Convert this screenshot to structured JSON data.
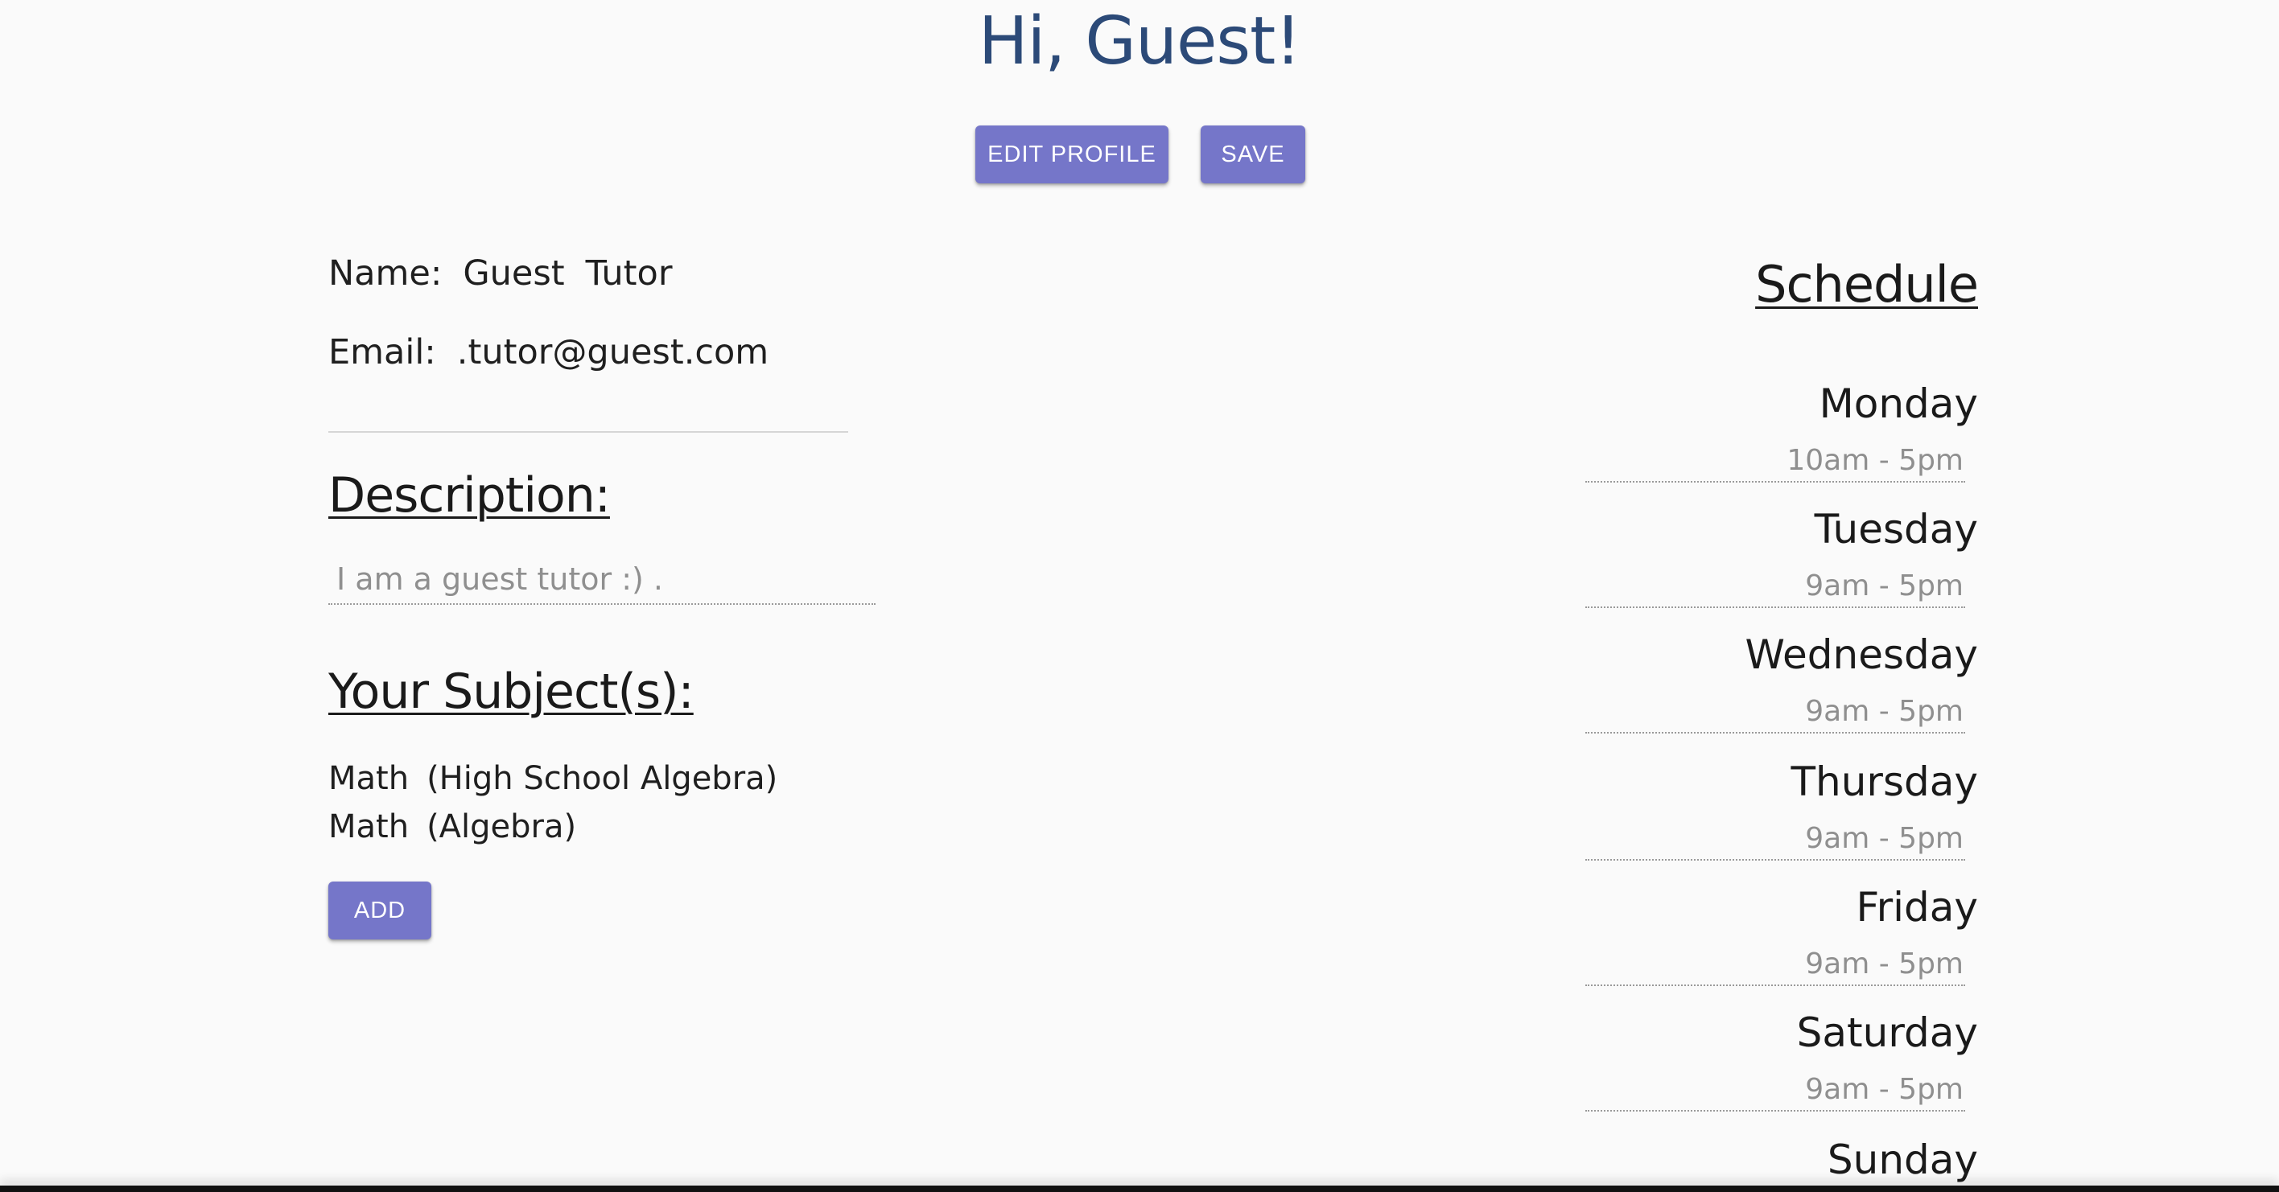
{
  "header": {
    "greeting": "Hi, Guest!",
    "edit_profile_label": "EDIT PROFILE",
    "save_label": "SAVE"
  },
  "profile": {
    "name_label": "Name:",
    "first_name": "Guest",
    "last_name": "Tutor",
    "email_label": "Email:",
    "email": ".tutor@guest.com"
  },
  "description": {
    "heading": "Description:",
    "value": "I am a guest tutor :) ."
  },
  "subjects": {
    "heading": "Your Subject(s):",
    "items": [
      {
        "subject": "Math",
        "level": "(High School Algebra)"
      },
      {
        "subject": "Math",
        "level": "(Algebra)"
      }
    ],
    "add_label": "ADD"
  },
  "schedule": {
    "heading": "Schedule",
    "days": [
      {
        "day": "Monday",
        "hours": "10am - 5pm"
      },
      {
        "day": "Tuesday",
        "hours": "9am - 5pm"
      },
      {
        "day": "Wednesday",
        "hours": "9am - 5pm"
      },
      {
        "day": "Thursday",
        "hours": "9am - 5pm"
      },
      {
        "day": "Friday",
        "hours": "9am - 5pm"
      },
      {
        "day": "Saturday",
        "hours": "9am - 5pm"
      },
      {
        "day": "Sunday",
        "hours": ""
      }
    ]
  },
  "colors": {
    "greeting": "#2c4a78",
    "button": "#7576c9",
    "background": "#fafafa",
    "muted_text": "#8f8f8f"
  }
}
